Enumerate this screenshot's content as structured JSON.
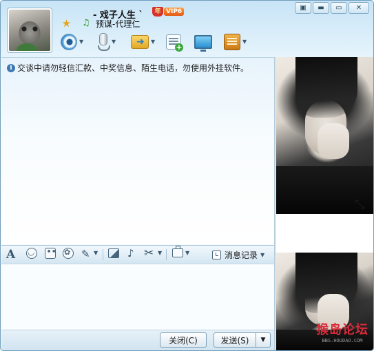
{
  "header": {
    "nickname": "- 戏子人生 `",
    "vip_crown": "年",
    "vip_label": "VIP6",
    "signature": "预谋-代理仁"
  },
  "window_controls": {
    "skin": "▣",
    "minimize": "▬",
    "maximize": "▭",
    "close": "✕"
  },
  "toolbar": {
    "items": [
      {
        "name": "video",
        "icon": "webcam-icon"
      },
      {
        "name": "voice",
        "icon": "microphone-icon"
      },
      {
        "name": "file-transfer",
        "icon": "folder-send-icon"
      },
      {
        "name": "create-discussion",
        "icon": "note-add-icon"
      },
      {
        "name": "remote-assist",
        "icon": "screen-share-icon"
      },
      {
        "name": "apps",
        "icon": "app-box-icon"
      }
    ]
  },
  "chat": {
    "notice": "交谈中请勿轻信汇款、中奖信息、陌生电话，勿使用外挂软件。"
  },
  "format_bar": {
    "font_glyph": "A",
    "history_label": "消息记录"
  },
  "buttons": {
    "close": "关闭(C)",
    "send": "发送(S)"
  },
  "watermark": {
    "logo": "猴岛论坛",
    "url": "BBS.HOUDAO.COM"
  },
  "colors": {
    "header_bg": "#c7e4f6",
    "accent": "#3d78b1",
    "vip": "#e25b16"
  }
}
